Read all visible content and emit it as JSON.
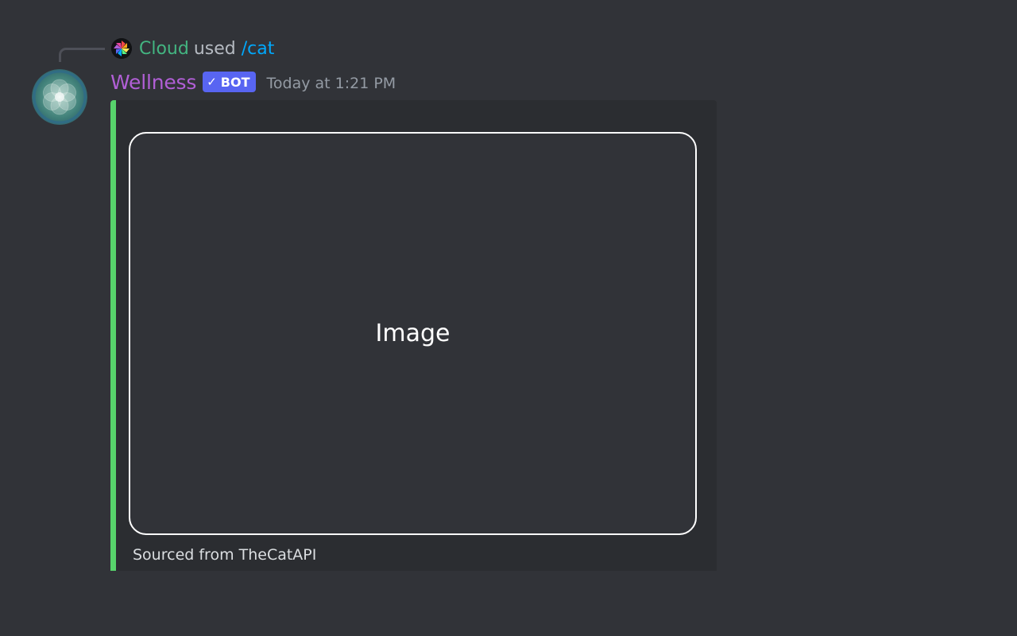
{
  "reply": {
    "user": "Cloud",
    "used_text": "used",
    "command": "/cat",
    "avatar_icon": "pinwheel-icon"
  },
  "message": {
    "username": "Wellness",
    "bot_tag": "BOT",
    "bot_check": "✓",
    "timestamp": "Today at 1:21 PM",
    "avatar_icon": "flower-of-life-icon"
  },
  "embed": {
    "accent_color": "#57d36b",
    "image_label": "Image",
    "footer": "Sourced from TheCatAPI"
  },
  "colors": {
    "background": "#313338",
    "embed_background": "#2b2d31",
    "username": "#b15fd6",
    "reply_user": "#43b581",
    "command": "#00a8fc",
    "bot_tag": "#5865f2"
  }
}
